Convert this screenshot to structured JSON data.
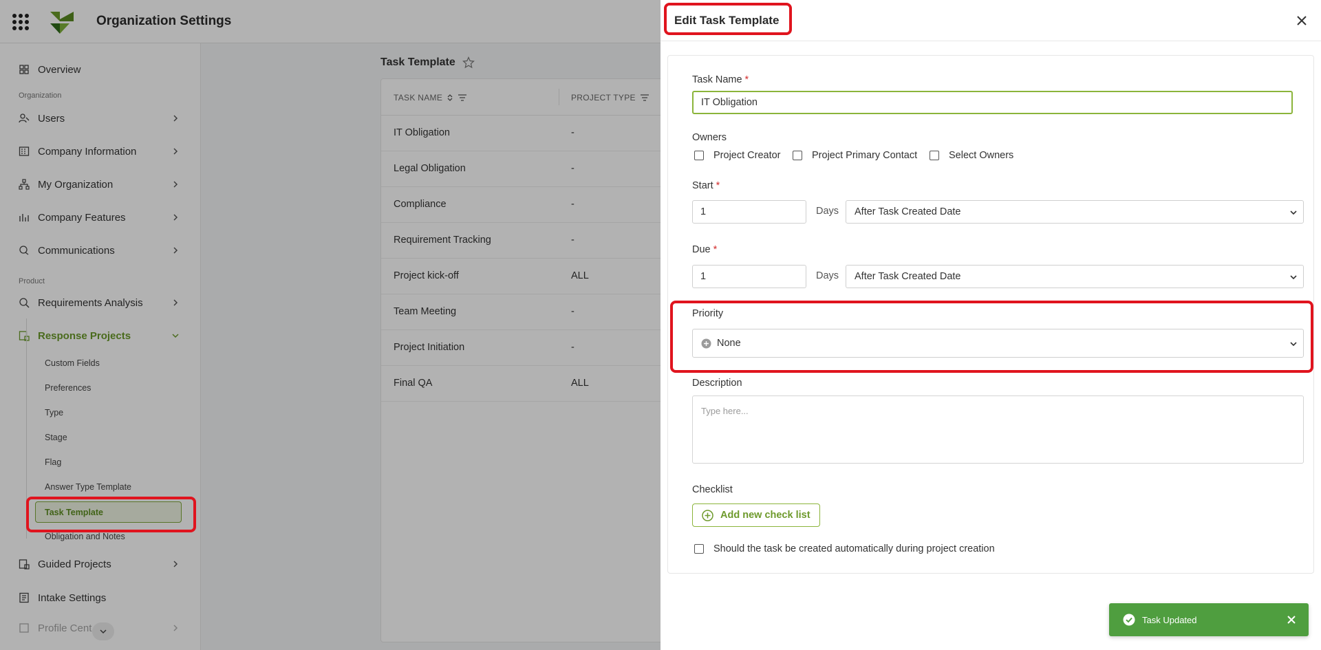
{
  "header": {
    "title": "Organization Settings",
    "apps_icon": "apps-grid-icon",
    "logo": "company-logo"
  },
  "sidebar": {
    "overview": "Overview",
    "section_organization": "Organization",
    "users": "Users",
    "company_information": "Company Information",
    "my_organization": "My Organization",
    "company_features": "Company Features",
    "communications": "Communications",
    "section_product": "Product",
    "requirements_analysis": "Requirements Analysis",
    "response_projects": "Response Projects",
    "sub_items": [
      "Custom Fields",
      "Preferences",
      "Type",
      "Stage",
      "Flag",
      "Answer Type Template",
      "Task Template",
      "Obligation and Notes"
    ],
    "guided_projects": "Guided Projects",
    "intake_settings": "Intake Settings",
    "profile_center": "Profile Cent"
  },
  "main": {
    "title": "Task Template",
    "columns": [
      "TASK NAME",
      "PROJECT TYPE"
    ],
    "rows": [
      [
        "IT Obligation",
        "-"
      ],
      [
        "Legal Obligation",
        "-"
      ],
      [
        "Compliance",
        "-"
      ],
      [
        "Requirement Tracking",
        "-"
      ],
      [
        "Project kick-off",
        "ALL"
      ],
      [
        "Team Meeting",
        "-"
      ],
      [
        "Project Initiation",
        "-"
      ],
      [
        "Final QA",
        "ALL"
      ]
    ]
  },
  "drawer": {
    "title": "Edit Task Template",
    "task_name_label": "Task Name",
    "required_mark": "*",
    "task_name_value": "IT Obligation",
    "owners_label": "Owners",
    "owners_options": [
      "Project Creator",
      "Project Primary Contact",
      "Select Owners"
    ],
    "start_label": "Start",
    "start_value": "1",
    "days_label": "Days",
    "start_relative": "After Task Created Date",
    "due_label": "Due",
    "due_value": "1",
    "due_relative": "After Task Created Date",
    "priority_label": "Priority",
    "priority_value": "None",
    "description_label": "Description",
    "description_placeholder": "Type here...",
    "checklist_label": "Checklist",
    "add_checklist_label": "Add new check list",
    "auto_create_label": "Should the task be created automatically during project creation"
  },
  "toast": {
    "message": "Task Updated"
  },
  "colors": {
    "accent_green": "#8bb43a",
    "highlight_red": "#e0141e",
    "toast_green": "#4f9e3f"
  }
}
